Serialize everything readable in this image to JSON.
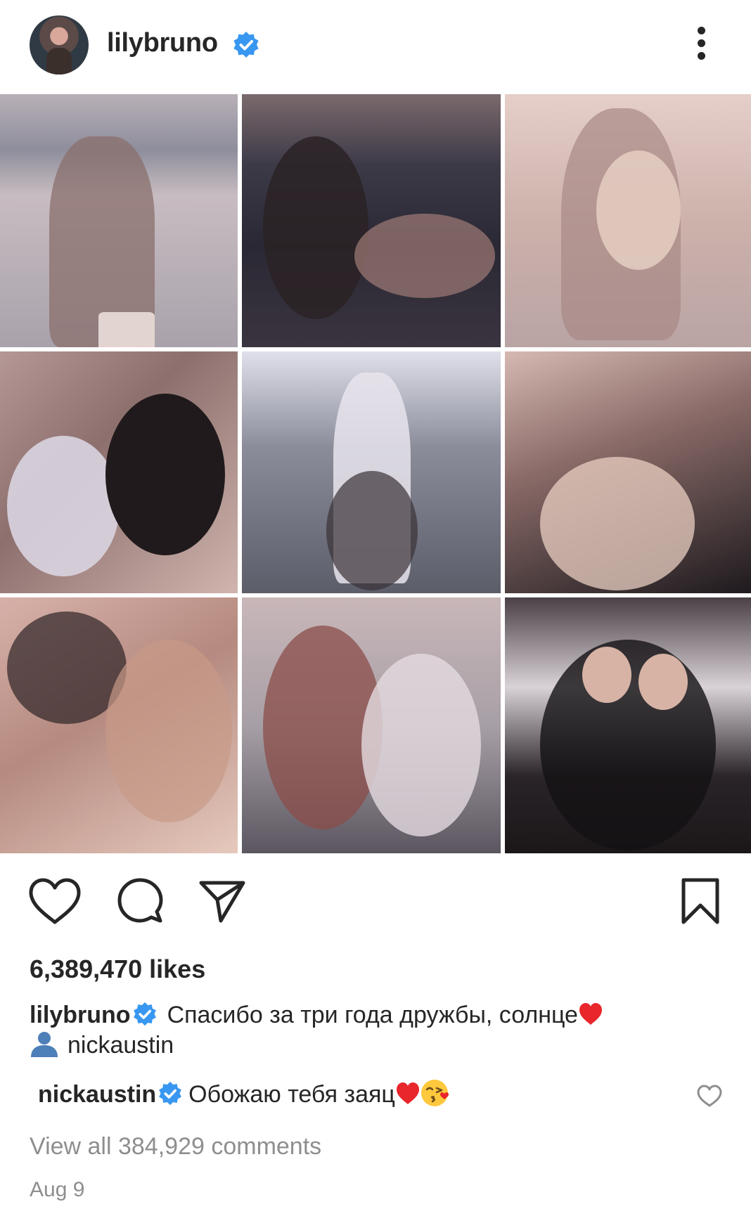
{
  "header": {
    "username": "lilybruno",
    "verified_color": "#3897f0",
    "more_icon": "more-vertical-icon"
  },
  "grid": {
    "photo_count": 9
  },
  "actions": {
    "like_icon": "heart-outline-icon",
    "comment_icon": "comment-bubble-icon",
    "share_icon": "paper-plane-icon",
    "save_icon": "bookmark-icon"
  },
  "likes_text": "6,389,470 likes",
  "caption": {
    "username": "lilybruno",
    "text": "Спасибо за три года дружбы, солнце",
    "emoji": "red-heart-emoji"
  },
  "tag": {
    "icon": "person-tag-icon",
    "username": "nickaustin"
  },
  "top_comment": {
    "username": "nickaustin",
    "text": "Обожаю тебя заяц",
    "emojis": [
      "red-heart-emoji",
      "face-blowing-kiss-emoji"
    ],
    "like_icon": "heart-outline-small-icon"
  },
  "view_all_comments": "View all 384,929 comments",
  "date": "Aug 9"
}
